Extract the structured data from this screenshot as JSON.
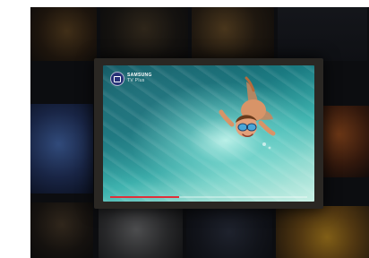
{
  "app": {
    "brand_line1": "SAMSUNG",
    "brand_line2": "TV Plus"
  },
  "player": {
    "progress_fraction": 0.35,
    "progress_color": "#e0303a"
  },
  "icons": {
    "logo": "tv-app-icon"
  }
}
